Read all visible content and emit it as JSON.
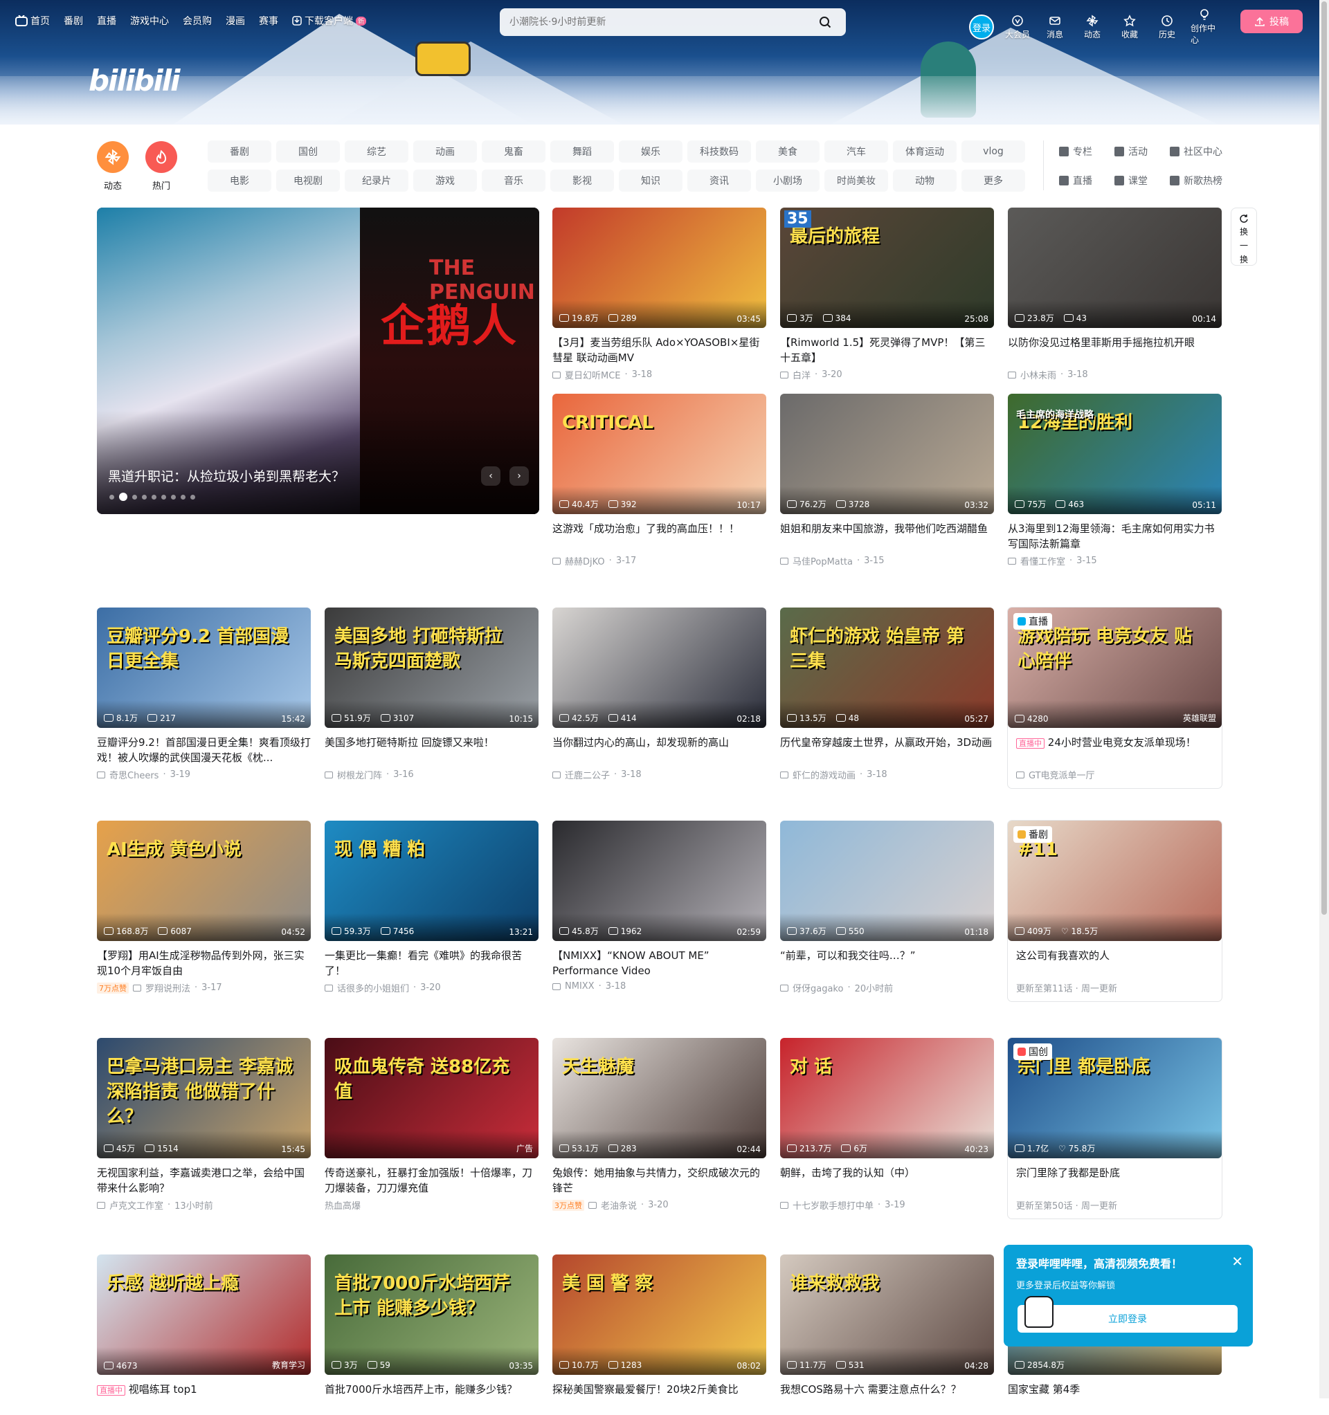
{
  "topnav": {
    "items": [
      "首页",
      "番剧",
      "直播",
      "游戏中心",
      "会员购",
      "漫画",
      "赛事",
      "下载客户端"
    ],
    "new_badge": "新"
  },
  "search": {
    "placeholder": "小潮院长·9小时前更新"
  },
  "header": {
    "login": "登录",
    "icons": [
      "大会员",
      "消息",
      "动态",
      "收藏",
      "历史",
      "创作中心"
    ],
    "upload": "投稿"
  },
  "logo": "bilibili",
  "channels": {
    "dynamic": "动态",
    "hot": "热门",
    "row1": [
      "番剧",
      "国创",
      "综艺",
      "动画",
      "鬼畜",
      "舞蹈",
      "娱乐",
      "科技数码",
      "美食",
      "汽车",
      "体育运动",
      "vlog"
    ],
    "row2": [
      "电影",
      "电视剧",
      "纪录片",
      "游戏",
      "音乐",
      "影视",
      "知识",
      "资讯",
      "小剧场",
      "时尚美妆",
      "动物",
      "更多"
    ],
    "side": [
      "专栏",
      "活动",
      "社区中心",
      "直播",
      "课堂",
      "新歌热榜"
    ]
  },
  "carousel": {
    "title": "黑道升职记：从捡垃圾小弟到黑帮老大？",
    "art_text": "企鹅人",
    "art_text2": "THE PENGUIN",
    "slides": 9,
    "active": 1,
    "prev": "‹",
    "next": "›"
  },
  "refresh_label": [
    "换",
    "一",
    "换"
  ],
  "cards": [
    {
      "id": "c1",
      "title": "【3月】麦当劳组乐队 Ado×YOASOBI×星街彗星 联动动画MV",
      "views": "19.8万",
      "danmaku": "289",
      "dur": "03:45",
      "up": "夏日幻听MCE",
      "date": "3-18",
      "thumb": "#c23a2a",
      "thumb2": "#f0c040"
    },
    {
      "id": "c2",
      "title": "【Rimworld 1.5】死灵弹得了MVP！【第三十五章】",
      "views": "3万",
      "danmaku": "384",
      "dur": "25:08",
      "up": "白洋",
      "date": "3-20",
      "thumb": "#5a4638",
      "thumb2": "#2f3b2a",
      "big": "最后的旅程",
      "num": "35"
    },
    {
      "id": "c3",
      "title": "以防你没见过格里菲斯用手摇拖拉机开眼",
      "views": "23.8万",
      "danmaku": "43",
      "dur": "00:14",
      "up": "小林未雨",
      "date": "3-18",
      "thumb": "#5b5a58",
      "thumb2": "#3a3634"
    },
    {
      "id": "c4",
      "title": "这游戏「成功治愈」了我的高血压！！！",
      "views": "40.4万",
      "danmaku": "392",
      "dur": "10:17",
      "up": "赫赫DjKO",
      "date": "3-17",
      "thumb": "#e9663c",
      "thumb2": "#f5d3b3",
      "big": "CRITICAL"
    },
    {
      "id": "c5",
      "title": "姐姐和朋友来中国旅游，我带他们吃西湖醋鱼",
      "views": "76.2万",
      "danmaku": "3728",
      "dur": "03:32",
      "up": "马佳PopMatta",
      "date": "3-15",
      "thumb": "#6b6a6a",
      "thumb2": "#b9a994"
    },
    {
      "id": "c6",
      "title": "从3海里到12海里领海：毛主席如何用实力书写国际法新篇章",
      "views": "75万",
      "danmaku": "463",
      "dur": "05:11",
      "up": "看懂工作室",
      "date": "3-15",
      "thumb": "#3f6a2c",
      "thumb2": "#2b84b8",
      "big": "12海里的胜利",
      "small": "毛主席的海洋战略"
    },
    {
      "id": "c7",
      "title": "豆瓣评分9.2！首部国漫日更全集！爽看顶级打戏！被人吹爆的武侠国漫天花板《枕...",
      "views": "8.1万",
      "danmaku": "217",
      "dur": "15:42",
      "up": "奇思Cheers",
      "date": "3-19",
      "thumb": "#3c6ea5",
      "thumb2": "#a8c8e8",
      "big": "豆瓣评分9.2 首部国漫 日更全集"
    },
    {
      "id": "c8",
      "title": "美国多地打砸特斯拉 回旋镖又来啦！",
      "views": "51.9万",
      "danmaku": "3107",
      "dur": "10:15",
      "up": "树根龙门阵",
      "date": "3-16",
      "thumb": "#3b3b3b",
      "thumb2": "#9aa0a6",
      "big": "美国多地 打砸特斯拉 马斯克四面楚歌"
    },
    {
      "id": "c9",
      "title": "当你翻过内心的高山，却发现新的高山",
      "views": "42.5万",
      "danmaku": "414",
      "dur": "02:18",
      "up": "迁鹿二公子",
      "date": "3-18",
      "thumb": "#d8d5d2",
      "thumb2": "#2a2d3a"
    },
    {
      "id": "c10",
      "title": "历代皇帝穿越废土世界，从赢政开始，3D动画",
      "views": "13.5万",
      "danmaku": "48",
      "dur": "05:27",
      "up": "虾仁的游戏动画",
      "date": "3-18",
      "thumb": "#5a6b4a",
      "thumb2": "#8b3a2a",
      "big": "虾仁的游戏 始皇帝 第三集"
    },
    {
      "id": "c11",
      "live": true,
      "title": "24小时营业电竞女友派单现场！",
      "views": "4280",
      "tag": "英雄联盟",
      "up": "GT电竞派单一厅",
      "thumb": "#d9b0a8",
      "thumb2": "#6a4a48",
      "chip": "直播",
      "live_label": "直播中",
      "big": "游戏陪玩 电竞女友 贴心陪伴"
    },
    {
      "id": "c12",
      "title": "【罗翔】用AI生成淫秽物品传到外网，张三实现10个月牢饭自由",
      "views": "168.8万",
      "danmaku": "6087",
      "dur": "04:52",
      "up": "罗翔说刑法",
      "date": "3-17",
      "like": "7万点赞",
      "thumb": "#e6a14a",
      "thumb2": "#8d8b88",
      "big": "AI生成 黄色小说"
    },
    {
      "id": "c13",
      "title": "一集更比一集癫！看完《难哄》的我命很苦了！",
      "views": "59.3万",
      "danmaku": "7456",
      "dur": "13:21",
      "up": "话很多的小姐姐们",
      "date": "3-20",
      "thumb": "#1e8bc3",
      "thumb2": "#0d3f6a",
      "big": "现 偶 糟 粕"
    },
    {
      "id": "c14",
      "title": "【NMIXX】“KNOW ABOUT ME” Performance Video",
      "views": "45.8万",
      "danmaku": "1962",
      "dur": "02:59",
      "up": "NMIXX",
      "date": "3-18",
      "thumb": "#2a2a2e",
      "thumb2": "#b5b2b8"
    },
    {
      "id": "c15",
      "title": "“前辈，可以和我交往吗…？”",
      "views": "37.6万",
      "danmaku": "550",
      "dur": "01:18",
      "up": "伢伢gagako",
      "date": "20小时前",
      "thumb": "#8fb8d8",
      "thumb2": "#d8d0cf"
    },
    {
      "id": "c16",
      "bangumi": true,
      "title": "这公司有我喜欢的人",
      "views": "409万",
      "follows": "18.5万",
      "up_text": "更新至第11话 · 周一更新",
      "thumb": "#e7d9c9",
      "thumb2": "#b76a5a",
      "chip": "番剧",
      "big": "#11"
    },
    {
      "id": "c17",
      "title": "无视国家利益，李嘉诚卖港口之举，会给中国带来什么影响？",
      "views": "45万",
      "danmaku": "1514",
      "dur": "15:45",
      "up": "卢克文工作室",
      "date": "13小时前",
      "thumb": "#2d4a6e",
      "thumb2": "#c8a36a",
      "big": "巴拿马港口易主 李嘉诚深陷指责 他做错了什么？"
    },
    {
      "id": "c18",
      "ad": true,
      "title": "传奇送豪礼，狂暴打金加强版！十倍爆率，刀刀爆装备，刀刀爆充值",
      "views": "",
      "dur": "广告",
      "up": "热血高爆",
      "thumb": "#4a0d16",
      "thumb2": "#c92d3a",
      "big": "吸血鬼传奇 送88亿充值"
    },
    {
      "id": "c19",
      "title": "兔娘传：她用抽象与共情力，交织成破次元的锋芒",
      "views": "53.1万",
      "danmaku": "283",
      "dur": "02:44",
      "up": "老油条说",
      "date": "3-20",
      "like": "3万点赞",
      "thumb": "#e9e4e0",
      "thumb2": "#4a3a36",
      "big": "天生魅魔"
    },
    {
      "id": "c20",
      "title": "朝鲜，击垮了我的认知（中）",
      "views": "213.7万",
      "danmaku": "6万",
      "dur": "40:23",
      "up": "十七岁歌手想打中单",
      "date": "3-19",
      "thumb": "#c7232b",
      "thumb2": "#e8e0d8",
      "big": "对 话"
    },
    {
      "id": "c21",
      "guochuang": true,
      "title": "宗门里除了我都是卧底",
      "views": "1.7亿",
      "follows": "75.8万",
      "up_text": "更新至第50话 · 周一更新",
      "thumb": "#1f4f8a",
      "thumb2": "#7ac4e6",
      "chip": "国创",
      "big": "宗门里 都是卧底"
    },
    {
      "id": "c22",
      "live": true,
      "title": "视唱练耳 top1",
      "views": "4673",
      "tag": "教育学习",
      "thumb": "#d3e4ef",
      "thumb2": "#b22b2b",
      "live_label": "直播中",
      "big": "乐感 越听越上瘾"
    },
    {
      "id": "c23",
      "title": "首批7000斤水培西芹上市，能赚多少钱？",
      "views": "3万",
      "danmaku": "59",
      "dur": "03:35",
      "thumb": "#486b3a",
      "thumb2": "#9bb47a",
      "big": "首批7000斤水培西芹上市 能赚多少钱？"
    },
    {
      "id": "c24",
      "title": "探秘美国警察最爱餐厅！20块2斤美食比",
      "views": "10.7万",
      "danmaku": "1283",
      "dur": "08:02",
      "thumb": "#b5472d",
      "thumb2": "#f2c94c",
      "big": "美 国 警 察"
    },
    {
      "id": "c25",
      "title": "我想COS路易十六 需要注意点什么？？",
      "views": "11.7万",
      "danmaku": "531",
      "dur": "04:28",
      "thumb": "#d4c9bf",
      "thumb2": "#5e4a44",
      "big": "谁来救救我"
    },
    {
      "id": "c26",
      "title": "国家宝藏 第4季",
      "views": "2854.8万",
      "thumb": "#2c6a8a",
      "thumb2": "#c7a86a"
    }
  ],
  "popup": {
    "title": "登录哔哩哔哩，高清视频免费看！",
    "subtitle": "更多登录后权益等你解锁",
    "button": "立即登录",
    "close": "✕"
  }
}
